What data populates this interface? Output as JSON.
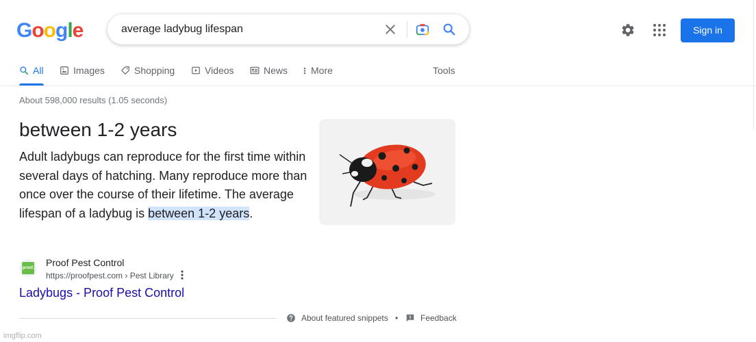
{
  "header": {
    "logo_letters": [
      {
        "ch": "G",
        "color": "#4285F4"
      },
      {
        "ch": "o",
        "color": "#EA4335"
      },
      {
        "ch": "o",
        "color": "#FBBC05"
      },
      {
        "ch": "g",
        "color": "#4285F4"
      },
      {
        "ch": "l",
        "color": "#34A853"
      },
      {
        "ch": "e",
        "color": "#EA4335"
      }
    ],
    "search_query": "average ladybug lifespan",
    "signin_label": "Sign in",
    "icons": [
      "clear-icon",
      "camera-icon",
      "search-icon",
      "settings-icon",
      "apps-icon"
    ]
  },
  "tabs": {
    "items": [
      {
        "label": "All",
        "icon": "search-icon",
        "active": true
      },
      {
        "label": "Images",
        "icon": "image-icon"
      },
      {
        "label": "Shopping",
        "icon": "tag-icon"
      },
      {
        "label": "Videos",
        "icon": "play-icon"
      },
      {
        "label": "News",
        "icon": "news-icon"
      },
      {
        "label": "More",
        "icon": "more-vert-icon"
      }
    ],
    "tools_label": "Tools"
  },
  "results": {
    "stats": "About 598,000 results (1.05 seconds)",
    "featured": {
      "answer": "between 1-2 years",
      "text_before": "Adult ladybugs can reproduce for the first time within several days of hatching. Many reproduce more than once over the course of their lifetime. The average lifespan of a ladybug is ",
      "text_highlight": "between 1-2 years",
      "text_after": ".",
      "image_alt": "ladybug-image",
      "source_name": "Proof Pest Control",
      "source_url": "https://proofpest.com › Pest Library",
      "favicon_text": "proof.",
      "link_title": "Ladybugs - Proof Pest Control",
      "about_label": "About featured snippets",
      "separator": "•",
      "feedback_label": "Feedback"
    }
  },
  "watermark": "imgflip.com",
  "colors": {
    "accent": "#1a73e8",
    "link": "#1a0dab",
    "highlight": "#d2e3fc"
  }
}
